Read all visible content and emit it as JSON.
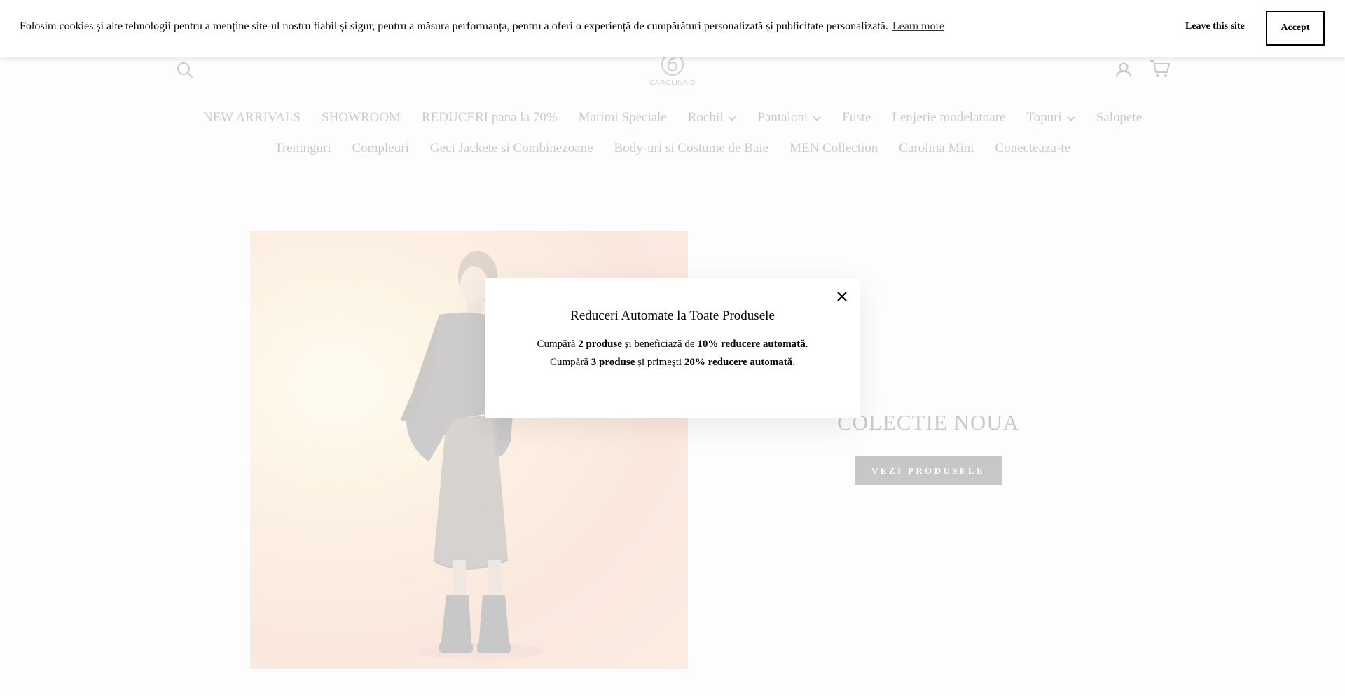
{
  "cookie_bar": {
    "message": "Folosim cookies și alte tehnologii pentru a menține site-ul nostru fiabil și sigur, pentru a măsura performanța, pentru a oferi o experiență de cumpărături personalizată și publicitate personalizată.",
    "learn_more": "Learn more",
    "leave_label": "Leave this site",
    "accept_label": "Accept"
  },
  "header": {
    "logo_text": "CAROLINA D",
    "icons": [
      "search-icon",
      "account-icon",
      "cart-icon"
    ]
  },
  "nav": {
    "row1": [
      {
        "label": "NEW ARRIVALS",
        "dropdown": false
      },
      {
        "label": "SHOWROOM",
        "dropdown": false
      },
      {
        "label": "REDUCERI pana la 70%",
        "dropdown": false
      },
      {
        "label": "Marimi Speciale",
        "dropdown": false
      },
      {
        "label": "Rochii",
        "dropdown": true
      },
      {
        "label": "Pantaloni",
        "dropdown": true
      },
      {
        "label": "Fuste",
        "dropdown": false
      },
      {
        "label": "Lenjerie modelatoare",
        "dropdown": false
      },
      {
        "label": "Topuri",
        "dropdown": true
      },
      {
        "label": "Salopete",
        "dropdown": false
      }
    ],
    "row2": [
      {
        "label": "Treninguri"
      },
      {
        "label": "Compleuri"
      },
      {
        "label": "Geci Jackete si Combinezoane"
      },
      {
        "label": "Body-uri si Costume de Baie"
      },
      {
        "label": "MEN Collection"
      },
      {
        "label": "Carolina Mini"
      },
      {
        "label": "Conecteaza-te"
      }
    ]
  },
  "hero": {
    "title": "COLECTIE NOUA",
    "button_label": "VEZI PRODUSELE"
  },
  "popup": {
    "title": "Reduceri Automate la Toate Produsele",
    "line1": {
      "icon": "",
      "pre": "Cumpără ",
      "qty": "2 produse",
      "mid": " și beneficiază de ",
      "discount": "10% reducere automată",
      "post": "."
    },
    "line2": {
      "icon": "",
      "pre": "Cumpără ",
      "qty": "3 produse",
      "mid": " și primești ",
      "discount": "20% reducere automată",
      "post": "."
    }
  },
  "colors": {
    "button_bg": "#111111",
    "overlay": "rgba(255,255,255,0.65)"
  }
}
